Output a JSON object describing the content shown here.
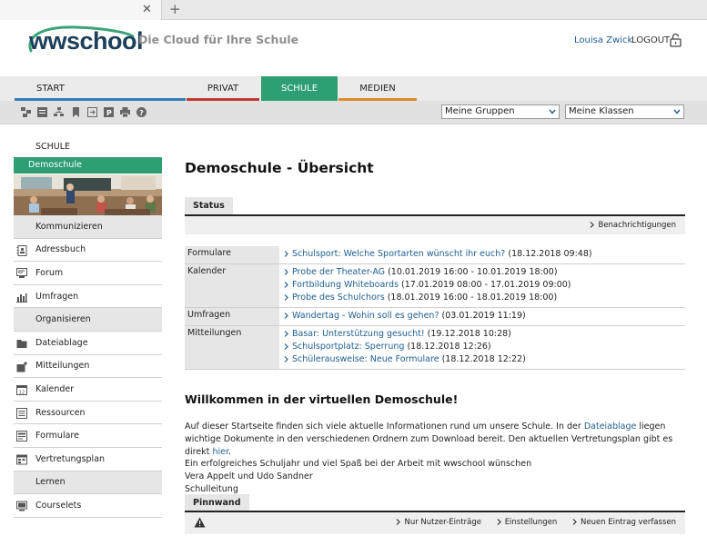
{
  "header": {
    "logo": "wwschool",
    "tagline": "Die Cloud für Ihre Schule",
    "user": "Louisa Zwick",
    "logout": "LOGOUT"
  },
  "nav": {
    "tabs": [
      {
        "label": "START",
        "color": "#2e7fb8"
      },
      {
        "label": "PRIVAT",
        "color": "#c0392b"
      },
      {
        "label": "SCHULE",
        "color": "#2e9f72",
        "active": true
      },
      {
        "label": "MEDIEN",
        "color": "#e08a2a"
      }
    ]
  },
  "toolbar": {
    "icons": [
      "network-icon",
      "list-icon",
      "tree-icon",
      "bookmark-icon",
      "export-icon",
      "info-icon",
      "p-icon",
      "print-icon",
      "help-icon"
    ],
    "groups_select": "Meine Gruppen",
    "classes_select": "Meine Klassen"
  },
  "sidebar": {
    "heading": "SCHULE",
    "active": "Demoschule",
    "rows": [
      {
        "type": "group",
        "label": "Kommunizieren"
      },
      {
        "type": "item",
        "label": "Adressbuch",
        "icon": "address-book-icon"
      },
      {
        "type": "item",
        "label": "Forum",
        "icon": "forum-icon"
      },
      {
        "type": "item",
        "label": "Umfragen",
        "icon": "poll-icon"
      },
      {
        "type": "group",
        "label": "Organisieren"
      },
      {
        "type": "item",
        "label": "Dateiablage",
        "icon": "folder-icon"
      },
      {
        "type": "item",
        "label": "Mitteilungen",
        "icon": "message-icon"
      },
      {
        "type": "item",
        "label": "Kalender",
        "icon": "calendar-icon"
      },
      {
        "type": "item",
        "label": "Ressourcen",
        "icon": "resources-icon"
      },
      {
        "type": "item",
        "label": "Formulare",
        "icon": "forms-icon"
      },
      {
        "type": "item",
        "label": "Vertretungsplan",
        "icon": "schedule-icon"
      },
      {
        "type": "group",
        "label": "Lernen"
      },
      {
        "type": "item",
        "label": "Courselets",
        "icon": "courselets-icon"
      }
    ]
  },
  "main": {
    "title": "Demoschule - Übersicht",
    "status_tab": "Status",
    "notifications": "Benachrichtigungen",
    "status": [
      {
        "label": "Formulare",
        "entries": [
          {
            "text": "Schulsport: Welche Sportarten wünscht ihr euch?",
            "meta": "(18.12.2018 09:48)"
          }
        ]
      },
      {
        "label": "Kalender",
        "entries": [
          {
            "text": "Probe der Theater-AG",
            "meta": "(10.01.2019 16:00 - 10.01.2019 18:00)"
          },
          {
            "text": "Fortbildung Whiteboards",
            "meta": "(17.01.2019 08:00 - 17.01.2019 09:00)"
          },
          {
            "text": "Probe des Schulchors",
            "meta": "(18.01.2019 16:00 - 18.01.2019 18:00)"
          }
        ]
      },
      {
        "label": "Umfragen",
        "entries": [
          {
            "text": "Wandertag - Wohin soll es gehen?",
            "meta": "(03.01.2019 11:19)"
          }
        ]
      },
      {
        "label": "Mitteilungen",
        "entries": [
          {
            "text": "Basar: Unterstützung gesucht!",
            "meta": "(19.12.2018 10:28)"
          },
          {
            "text": "Schulsportplatz: Sperrung",
            "meta": "(18.12.2018 12:26)"
          },
          {
            "text": "Schülerausweise: Neue Formulare",
            "meta": "(18.12.2018 12:22)"
          }
        ]
      }
    ],
    "welcome": {
      "title": "Willkommen in der virtuellen Demoschule!",
      "p1_a": "Auf dieser Startseite finden sich viele aktuelle Informationen rund um unsere Schule. In der ",
      "p1_link": "Dateiablage",
      "p1_b": " liegen wichtige Dokumente in den verschiedenen Ordnern zum Download bereit. Den aktuellen Vertretungsplan gibt es direkt ",
      "p1_link2": "hier",
      "p1_c": ".",
      "line2": "Ein erfolgreiches Schuljahr und viel Spaß bei der Arbeit mit wwschool wünschen",
      "line3": "Vera Appelt und Udo Sandner",
      "line4": "Schulleitung"
    },
    "pinnwand": {
      "tab": "Pinnwand",
      "actions": [
        "Nur Nutzer-Einträge",
        "Einstellungen",
        "Neuen Eintrag verfassen"
      ]
    }
  }
}
